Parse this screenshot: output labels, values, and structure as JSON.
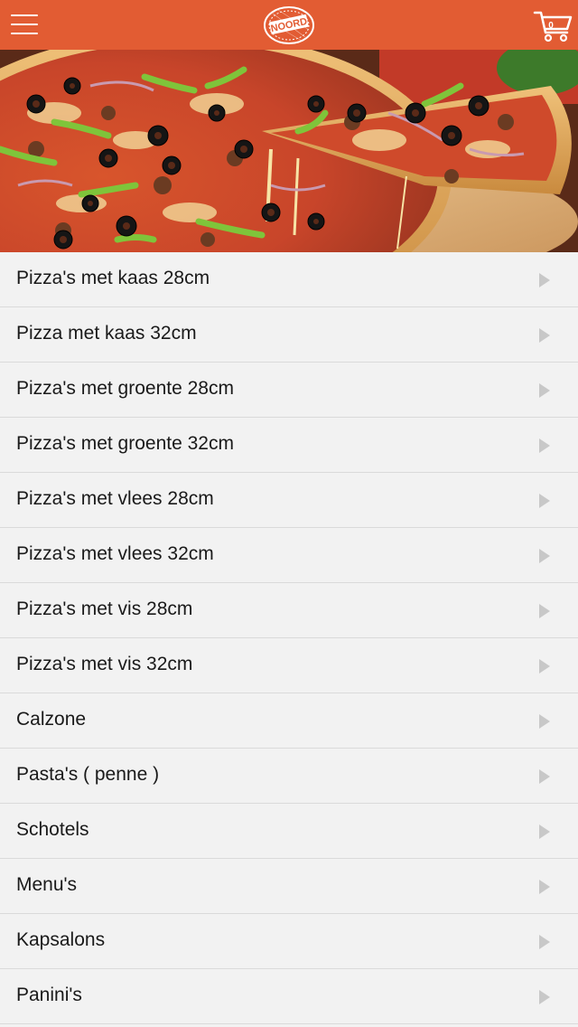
{
  "header": {
    "menu_icon": "hamburger-menu-icon",
    "logo_text": "NOORD",
    "cart_icon": "shopping-cart-icon",
    "cart_count": "0"
  },
  "hero": {
    "image": "pizza-hero-image"
  },
  "categories": [
    {
      "label": "Pizza's met kaas 28cm"
    },
    {
      "label": "Pizza met kaas 32cm"
    },
    {
      "label": "Pizza's met groente 28cm"
    },
    {
      "label": "Pizza's met groente 32cm"
    },
    {
      "label": "Pizza's met vlees 28cm"
    },
    {
      "label": "Pizza's met vlees 32cm"
    },
    {
      "label": "Pizza's met vis 28cm"
    },
    {
      "label": "Pizza's met vis 32cm"
    },
    {
      "label": "Calzone"
    },
    {
      "label": "Pasta's ( penne )"
    },
    {
      "label": "Schotels"
    },
    {
      "label": "Menu's"
    },
    {
      "label": "Kapsalons"
    },
    {
      "label": "Panini's"
    }
  ],
  "colors": {
    "header_bg": "#e25c33",
    "list_bg": "#f2f2f2",
    "divider": "#dadada",
    "chevron": "#c8c8c8",
    "text": "#1a1a1a"
  }
}
